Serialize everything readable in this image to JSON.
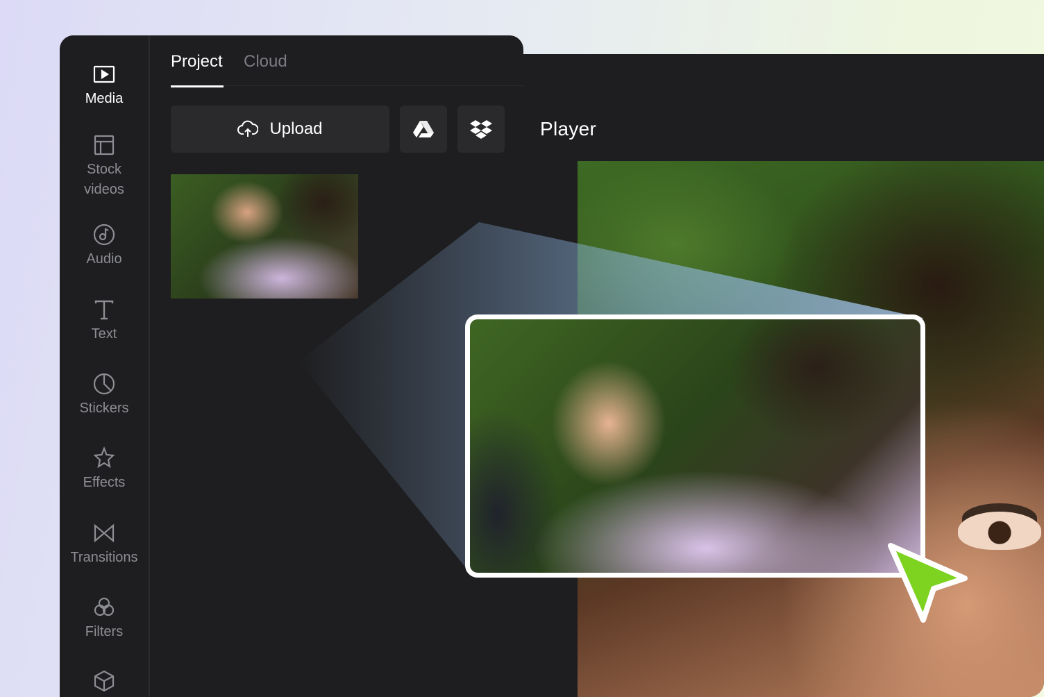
{
  "sidebar": {
    "items": [
      {
        "label": "Media",
        "icon": "media-icon",
        "active": true
      },
      {
        "label": "Stock\nvideos",
        "icon": "stock-videos-icon"
      },
      {
        "label": "Audio",
        "icon": "audio-icon"
      },
      {
        "label": "Text",
        "icon": "text-icon"
      },
      {
        "label": "Stickers",
        "icon": "stickers-icon"
      },
      {
        "label": "Effects",
        "icon": "effects-icon"
      },
      {
        "label": "Transitions",
        "icon": "transitions-icon"
      },
      {
        "label": "Filters",
        "icon": "filters-icon"
      },
      {
        "label": "",
        "icon": "elements-icon"
      }
    ]
  },
  "tabs": [
    {
      "label": "Project",
      "active": true
    },
    {
      "label": "Cloud",
      "active": false
    }
  ],
  "upload": {
    "label": "Upload",
    "icon": "cloud-upload-icon"
  },
  "integrations": [
    {
      "icon": "google-drive-icon"
    },
    {
      "icon": "dropbox-icon"
    }
  ],
  "player": {
    "title": "Player"
  },
  "colors": {
    "panel": "#1e1e20",
    "button": "#2a2a2d",
    "cursor": "#7ed321",
    "text_active": "#ffffff",
    "text_muted": "#8d8e94"
  }
}
